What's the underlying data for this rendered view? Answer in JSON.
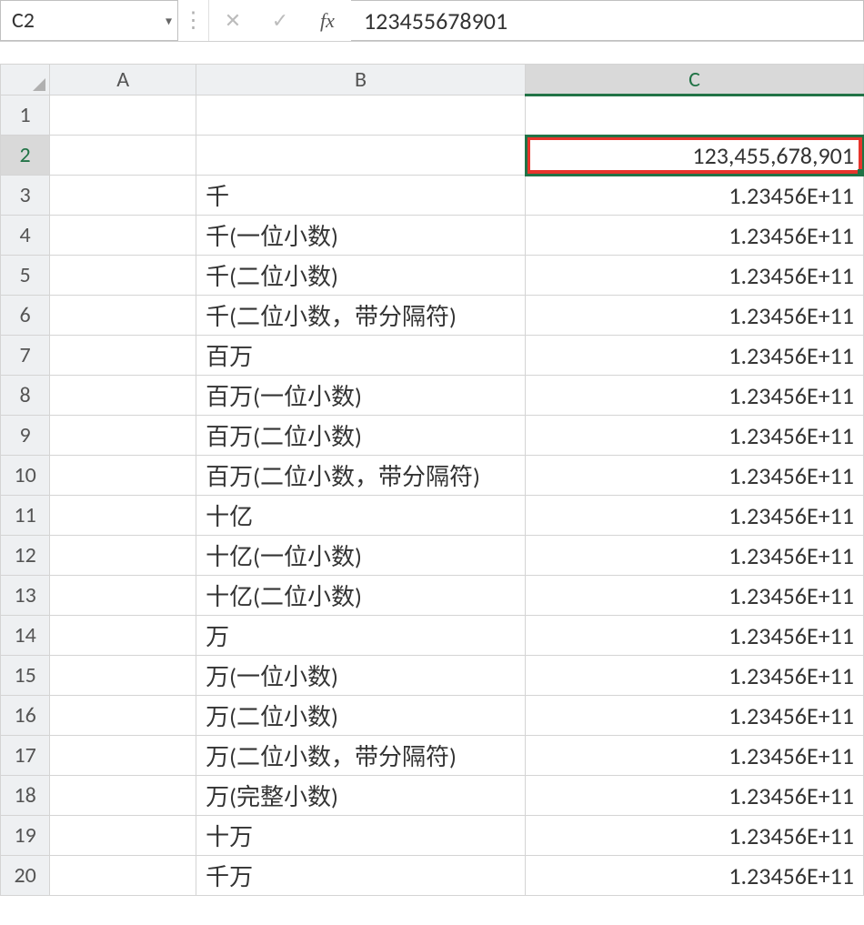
{
  "formula_bar": {
    "name_box": "C2",
    "dropdown_glyph": "▾",
    "separator_glyph": "⋮",
    "cancel_glyph": "✕",
    "enter_glyph": "✓",
    "fx_label": "fx",
    "formula_value": "123455678901"
  },
  "columns": {
    "A": "A",
    "B": "B",
    "C": "C"
  },
  "active": {
    "row": 2,
    "col": "C"
  },
  "rows": [
    {
      "n": 1,
      "A": "",
      "B": "",
      "C": ""
    },
    {
      "n": 2,
      "A": "",
      "B": "",
      "C": "123,455,678,901"
    },
    {
      "n": 3,
      "A": "",
      "B": "千",
      "C": "1.23456E+11"
    },
    {
      "n": 4,
      "A": "",
      "B": "千(一位小数)",
      "C": "1.23456E+11"
    },
    {
      "n": 5,
      "A": "",
      "B": "千(二位小数)",
      "C": "1.23456E+11"
    },
    {
      "n": 6,
      "A": "",
      "B": "千(二位小数，带分隔符)",
      "C": "1.23456E+11"
    },
    {
      "n": 7,
      "A": "",
      "B": "百万",
      "C": "1.23456E+11"
    },
    {
      "n": 8,
      "A": "",
      "B": "百万(一位小数)",
      "C": "1.23456E+11"
    },
    {
      "n": 9,
      "A": "",
      "B": "百万(二位小数)",
      "C": "1.23456E+11"
    },
    {
      "n": 10,
      "A": "",
      "B": "百万(二位小数，带分隔符)",
      "C": "1.23456E+11"
    },
    {
      "n": 11,
      "A": "",
      "B": "十亿",
      "C": "1.23456E+11"
    },
    {
      "n": 12,
      "A": "",
      "B": "十亿(一位小数)",
      "C": "1.23456E+11"
    },
    {
      "n": 13,
      "A": "",
      "B": "十亿(二位小数)",
      "C": "1.23456E+11"
    },
    {
      "n": 14,
      "A": "",
      "B": "万",
      "C": "1.23456E+11"
    },
    {
      "n": 15,
      "A": "",
      "B": "万(一位小数)",
      "C": "1.23456E+11"
    },
    {
      "n": 16,
      "A": "",
      "B": "万(二位小数)",
      "C": "1.23456E+11"
    },
    {
      "n": 17,
      "A": "",
      "B": "万(二位小数，带分隔符)",
      "C": "1.23456E+11"
    },
    {
      "n": 18,
      "A": "",
      "B": "万(完整小数)",
      "C": "1.23456E+11"
    },
    {
      "n": 19,
      "A": "",
      "B": "十万",
      "C": "1.23456E+11"
    },
    {
      "n": 20,
      "A": "",
      "B": "千万",
      "C": "1.23456E+11"
    }
  ]
}
